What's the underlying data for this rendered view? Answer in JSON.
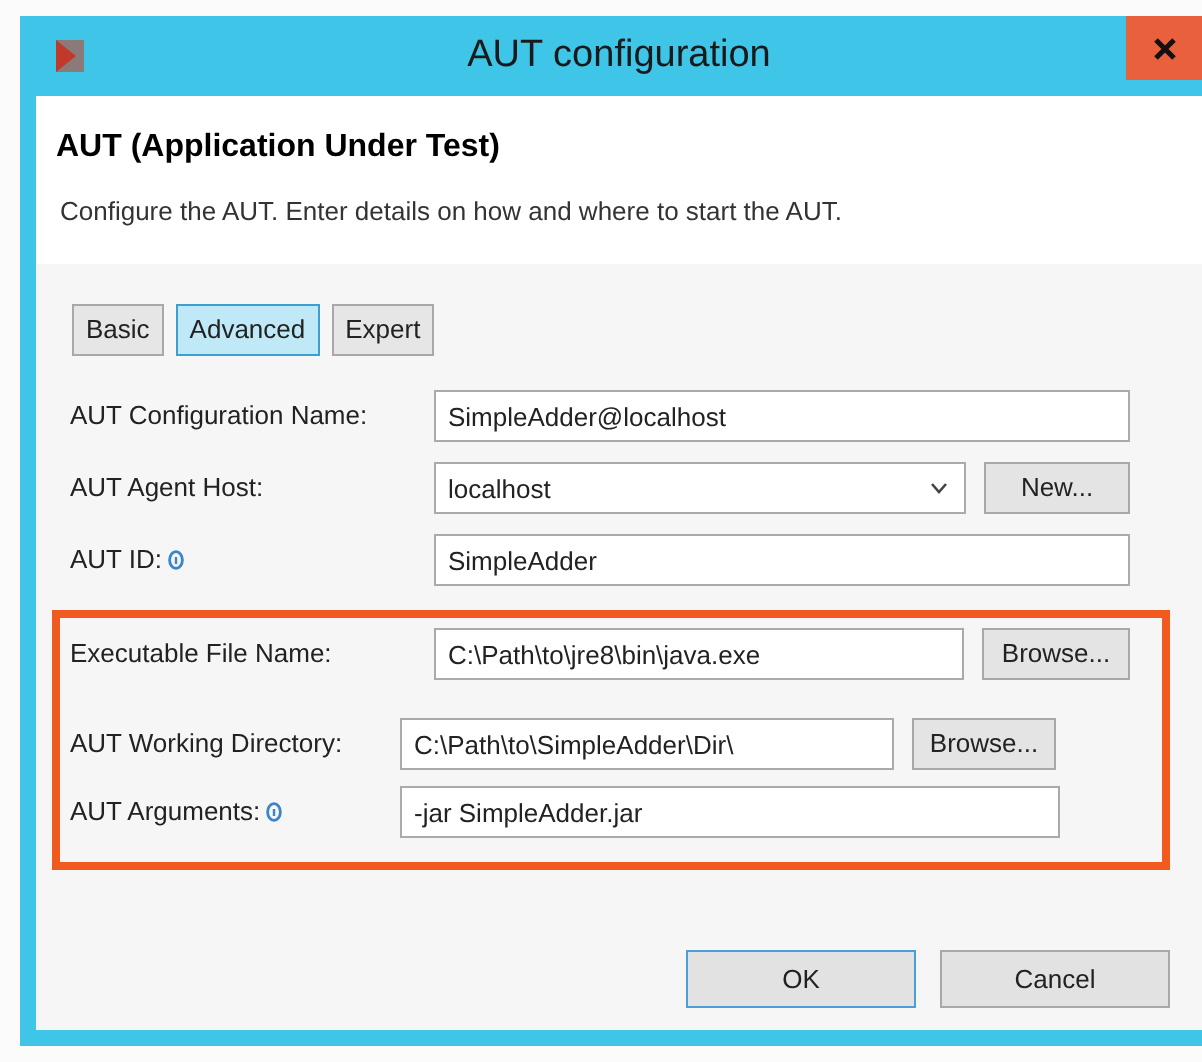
{
  "window": {
    "title": "AUT configuration"
  },
  "header": {
    "title": "AUT (Application Under Test)",
    "description": "Configure the AUT. Enter details on how and where to start the AUT."
  },
  "tabs": [
    {
      "label": "Basic",
      "selected": false
    },
    {
      "label": "Advanced",
      "selected": true
    },
    {
      "label": "Expert",
      "selected": false
    }
  ],
  "fields": [
    {
      "label": "AUT Configuration Name:",
      "info": false,
      "kind": "text",
      "value": "SimpleAdder@localhost"
    },
    {
      "label": "AUT Agent Host:",
      "info": false,
      "kind": "combo",
      "value": "localhost",
      "button": "New..."
    },
    {
      "label": "AUT ID:",
      "info": true,
      "kind": "text",
      "value": "SimpleAdder"
    }
  ],
  "highlighted_fields": [
    {
      "label": "Executable File Name:",
      "info": false,
      "kind": "text",
      "value": "C:\\Path\\to\\jre8\\bin\\java.exe",
      "button": "Browse..."
    },
    {
      "label": "AUT Working Directory:",
      "info": false,
      "kind": "text",
      "value": "C:\\Path\\to\\SimpleAdder\\Dir\\",
      "button": "Browse..."
    },
    {
      "label": "AUT Arguments:",
      "info": true,
      "kind": "text",
      "value": "-jar SimpleAdder.jar"
    }
  ],
  "buttons": [
    "OK",
    "Cancel"
  ]
}
